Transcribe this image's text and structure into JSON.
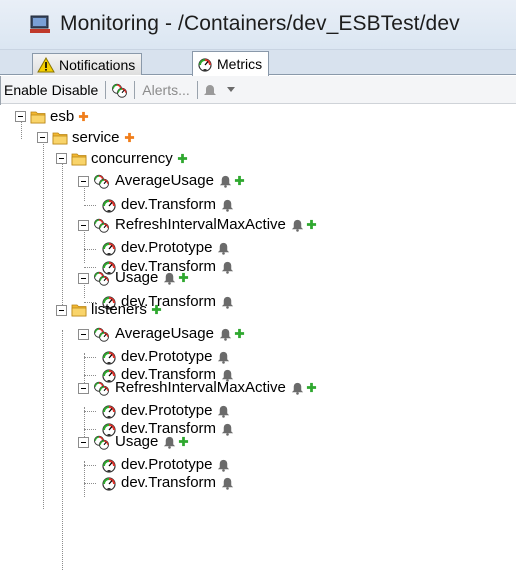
{
  "window": {
    "title": "Monitoring - /Containers/dev_ESBTest/dev"
  },
  "tabs": [
    {
      "label": "Notifications",
      "icon": "warning-icon",
      "active": false
    },
    {
      "label": "Metrics",
      "icon": "metrics-gauge-icon",
      "active": true
    }
  ],
  "toolbar": {
    "enable_label": "Enable",
    "disable_label": "Disable",
    "alerts_label": "Alerts...",
    "icons": [
      "metric-group-icon",
      "alert-bell-dropdown-icon"
    ]
  },
  "tree": {
    "colors": {
      "add": "#2fa82f",
      "add_orange": "#f07d1a",
      "bell": "#6b6b6b",
      "folder": "#f2b732"
    },
    "nodes": [
      {
        "label": "esb",
        "icon": "folder-icon",
        "suffix": "add-orange"
      },
      {
        "label": "service",
        "icon": "folder-icon",
        "suffix": "add-orange"
      },
      {
        "label": "concurrency",
        "icon": "folder-icon",
        "suffix": "add"
      },
      {
        "label": "AverageUsage",
        "icon": "metric-group-icon",
        "suffix": "bell-add"
      },
      {
        "label": "dev.Transform",
        "icon": "gauge-icon",
        "suffix": "bell"
      },
      {
        "label": "RefreshIntervalMaxActive",
        "icon": "metric-group-icon",
        "suffix": "bell-add"
      },
      {
        "label": "dev.Prototype",
        "icon": "gauge-icon",
        "suffix": "bell"
      },
      {
        "label": "dev.Transform",
        "icon": "gauge-icon",
        "suffix": "bell"
      },
      {
        "label": "Usage",
        "icon": "metric-group-icon",
        "suffix": "bell-add"
      },
      {
        "label": "dev.Transform",
        "icon": "gauge-icon",
        "suffix": "bell"
      },
      {
        "label": "listeners",
        "icon": "folder-icon",
        "suffix": "add"
      },
      {
        "label": "AverageUsage",
        "icon": "metric-group-icon",
        "suffix": "bell-add"
      },
      {
        "label": "dev.Prototype",
        "icon": "gauge-icon",
        "suffix": "bell"
      },
      {
        "label": "dev.Transform",
        "icon": "gauge-icon",
        "suffix": "bell"
      },
      {
        "label": "RefreshIntervalMaxActive",
        "icon": "metric-group-icon",
        "suffix": "bell-add"
      },
      {
        "label": "dev.Prototype",
        "icon": "gauge-icon",
        "suffix": "bell"
      },
      {
        "label": "dev.Transform",
        "icon": "gauge-icon",
        "suffix": "bell"
      },
      {
        "label": "Usage",
        "icon": "metric-group-icon",
        "suffix": "bell-add"
      },
      {
        "label": "dev.Prototype",
        "icon": "gauge-icon",
        "suffix": "bell"
      },
      {
        "label": "dev.Transform",
        "icon": "gauge-icon",
        "suffix": "bell"
      }
    ]
  }
}
